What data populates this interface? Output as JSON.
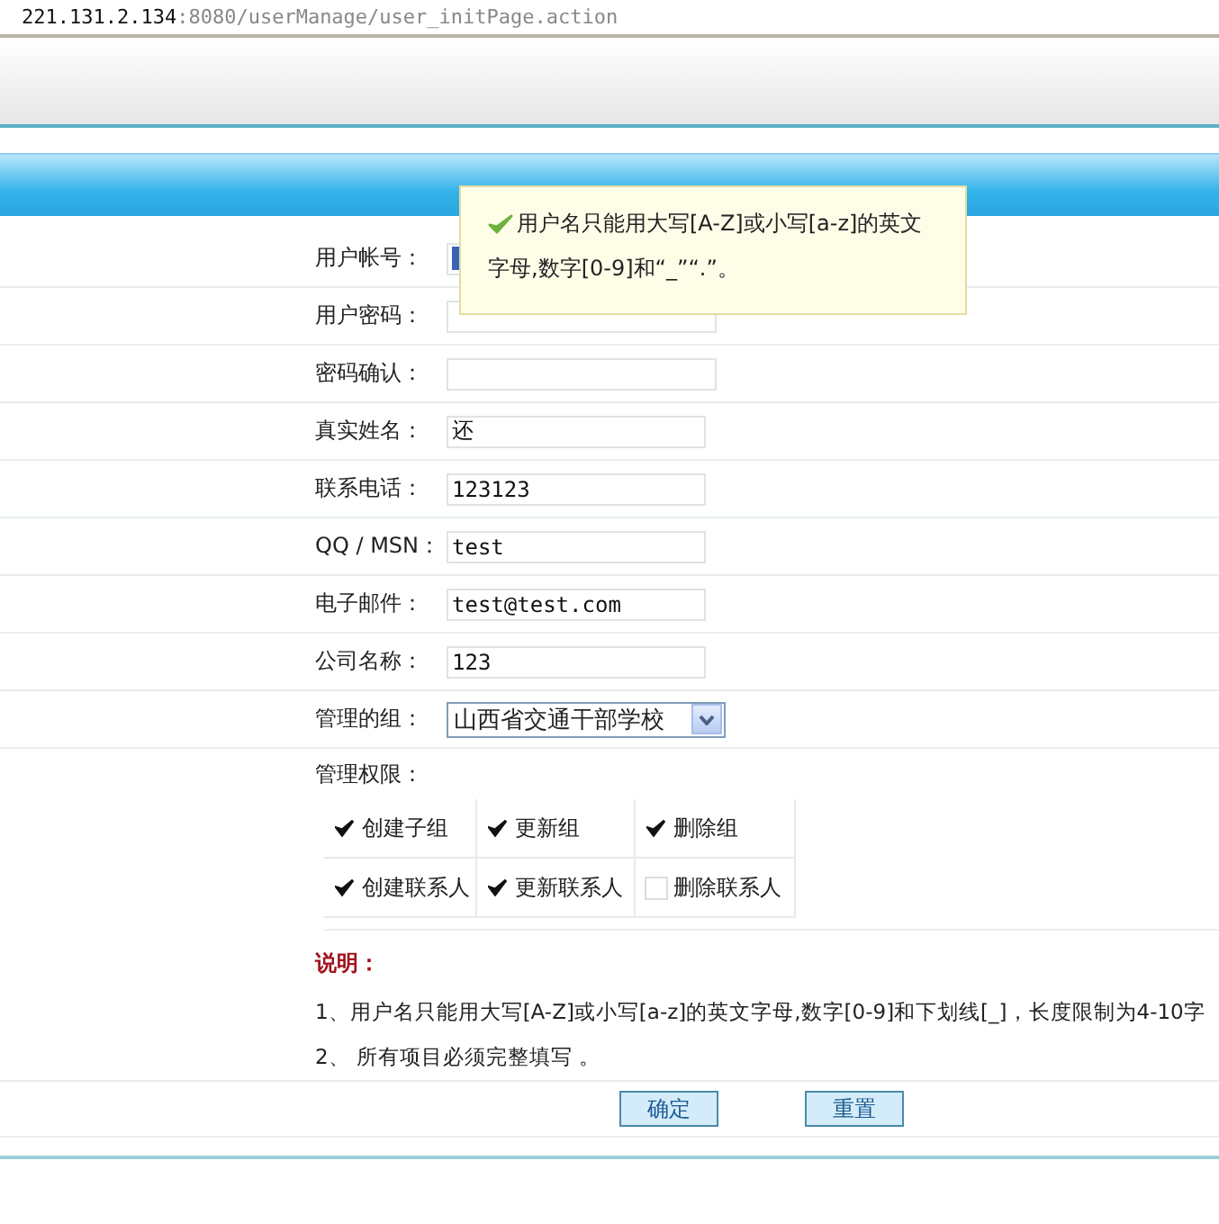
{
  "address_bar": {
    "host": "221.131.2.134",
    "path": ":8080/userManage/user_initPage.action"
  },
  "tooltip": {
    "lines": [
      "用户名只能用大写[A-Z]或小写[a-z]的英文",
      "字母,数字[0-9]和“_”“.”。"
    ]
  },
  "fields": [
    {
      "label": "用户帐号：",
      "kind": "text",
      "selected_text": true
    },
    {
      "label": "用户密码：",
      "kind": "password"
    },
    {
      "label": "密码确认：",
      "kind": "password"
    },
    {
      "label": "真实姓名：",
      "kind": "text",
      "value": "还"
    },
    {
      "label": "联系电话：",
      "kind": "text",
      "value": "123123"
    },
    {
      "label": "QQ / MSN：",
      "kind": "text",
      "value": "test"
    },
    {
      "label": "电子邮件：",
      "kind": "text",
      "value": "test@test.com"
    },
    {
      "label": "公司名称：",
      "kind": "text",
      "value": "123"
    },
    {
      "label": "管理的组：",
      "kind": "select",
      "value": "山西省交通干部学校"
    }
  ],
  "permissions": {
    "label": "管理权限：",
    "items": [
      {
        "label": "创建子组",
        "checked": true
      },
      {
        "label": "更新组",
        "checked": true
      },
      {
        "label": "删除组",
        "checked": true
      },
      {
        "label": "创建联系人",
        "checked": true
      },
      {
        "label": "更新联系人",
        "checked": true
      },
      {
        "label": "删除联系人",
        "checked": false
      }
    ]
  },
  "notes": {
    "title": "说明：",
    "lines": [
      "1、用户名只能用大写[A-Z]或小写[a-z]的英文字母,数字[0-9]和下划线[_]，长度限制为4-10字",
      "2、 所有项目必须完整填写 。"
    ]
  },
  "buttons": [
    "确定",
    "重置"
  ]
}
